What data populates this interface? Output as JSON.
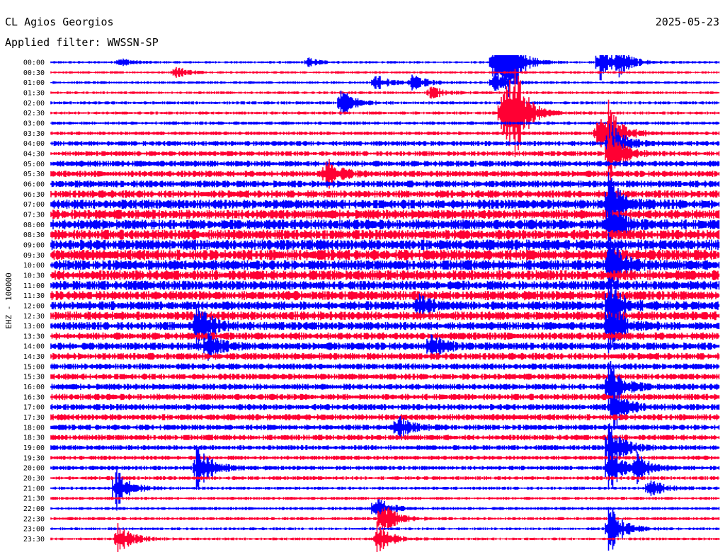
{
  "station": "CL Agios Georgios",
  "date": "2025-05-23",
  "filter_label": "Applied filter: WWSSN-SP",
  "channel_label": "EHZ - 100000",
  "colors": {
    "trace_a": "#0000ff",
    "trace_b": "#ff0033",
    "background": "#ffffff",
    "text": "#000000"
  },
  "chart_data": {
    "type": "line",
    "subtype": "helicorder",
    "row_interval_minutes": 30,
    "grid": false,
    "legend": "none",
    "row_labels": [
      "00:00",
      "00:30",
      "01:00",
      "01:30",
      "02:00",
      "02:30",
      "03:00",
      "03:30",
      "04:00",
      "04:30",
      "05:00",
      "05:30",
      "06:00",
      "06:30",
      "07:00",
      "07:30",
      "08:00",
      "08:30",
      "09:00",
      "09:30",
      "10:00",
      "10:30",
      "11:00",
      "11:30",
      "12:00",
      "12:30",
      "13:00",
      "13:30",
      "14:00",
      "14:30",
      "15:00",
      "15:30",
      "16:00",
      "16:30",
      "17:00",
      "17:30",
      "18:00",
      "18:30",
      "19:00",
      "19:30",
      "20:00",
      "20:30",
      "21:00",
      "21:30",
      "22:00",
      "22:30",
      "23:00",
      "23:30"
    ],
    "row_noise": [
      0.2,
      0.2,
      0.22,
      0.22,
      0.25,
      0.25,
      0.28,
      0.3,
      0.4,
      0.4,
      0.5,
      0.5,
      0.55,
      0.6,
      0.75,
      0.75,
      0.8,
      0.8,
      0.85,
      0.85,
      0.8,
      0.8,
      0.75,
      0.75,
      0.7,
      0.7,
      0.65,
      0.6,
      0.6,
      0.55,
      0.5,
      0.5,
      0.5,
      0.5,
      0.5,
      0.5,
      0.45,
      0.45,
      0.4,
      0.35,
      0.35,
      0.3,
      0.25,
      0.25,
      0.25,
      0.25,
      0.22,
      0.22
    ],
    "events": [
      {
        "row": 0,
        "minute": 3.0,
        "amp": 0.8
      },
      {
        "row": 0,
        "minute": 11.5,
        "amp": 0.7
      },
      {
        "row": 0,
        "minute": 19.8,
        "amp": 3.5
      },
      {
        "row": 0,
        "minute": 20.2,
        "amp": 4.0
      },
      {
        "row": 0,
        "minute": 20.5,
        "amp": 3.8
      },
      {
        "row": 0,
        "minute": 24.6,
        "amp": 3.5
      },
      {
        "row": 0,
        "minute": 25.5,
        "amp": 2.0
      },
      {
        "row": 1,
        "minute": 5.5,
        "amp": 1.2
      },
      {
        "row": 2,
        "minute": 14.5,
        "amp": 1.5
      },
      {
        "row": 2,
        "minute": 16.2,
        "amp": 1.5
      },
      {
        "row": 2,
        "minute": 19.8,
        "amp": 1.8
      },
      {
        "row": 3,
        "minute": 17.0,
        "amp": 1.2
      },
      {
        "row": 4,
        "minute": 13.0,
        "amp": 2.5
      },
      {
        "row": 5,
        "minute": 20.2,
        "amp": 4.5
      },
      {
        "row": 5,
        "minute": 20.5,
        "amp": 5.0
      },
      {
        "row": 5,
        "minute": 20.8,
        "amp": 4.5
      },
      {
        "row": 7,
        "minute": 24.5,
        "amp": 3.0
      },
      {
        "row": 7,
        "minute": 25.0,
        "amp": 4.5
      },
      {
        "row": 8,
        "minute": 25.0,
        "amp": 4.5
      },
      {
        "row": 9,
        "minute": 25.0,
        "amp": 5.0
      },
      {
        "row": 11,
        "minute": 12.3,
        "amp": 3.0
      },
      {
        "row": 14,
        "minute": 25.0,
        "amp": 5.0
      },
      {
        "row": 16,
        "minute": 25.0,
        "amp": 5.0
      },
      {
        "row": 20,
        "minute": 25.0,
        "amp": 5.0
      },
      {
        "row": 24,
        "minute": 25.0,
        "amp": 5.0
      },
      {
        "row": 24,
        "minute": 16.5,
        "amp": 1.5
      },
      {
        "row": 26,
        "minute": 6.5,
        "amp": 5.0
      },
      {
        "row": 26,
        "minute": 25.0,
        "amp": 5.0
      },
      {
        "row": 28,
        "minute": 7.0,
        "amp": 2.5
      },
      {
        "row": 28,
        "minute": 17.0,
        "amp": 2.2
      },
      {
        "row": 32,
        "minute": 25.0,
        "amp": 5.0
      },
      {
        "row": 34,
        "minute": 25.2,
        "amp": 4.0
      },
      {
        "row": 36,
        "minute": 15.5,
        "amp": 2.0
      },
      {
        "row": 38,
        "minute": 25.0,
        "amp": 5.0
      },
      {
        "row": 40,
        "minute": 6.5,
        "amp": 5.0
      },
      {
        "row": 40,
        "minute": 25.0,
        "amp": 5.0
      },
      {
        "row": 40,
        "minute": 26.3,
        "amp": 2.0
      },
      {
        "row": 42,
        "minute": 2.9,
        "amp": 4.0
      },
      {
        "row": 42,
        "minute": 26.8,
        "amp": 2.0
      },
      {
        "row": 44,
        "minute": 14.5,
        "amp": 2.5
      },
      {
        "row": 45,
        "minute": 14.8,
        "amp": 3.5
      },
      {
        "row": 46,
        "minute": 25.0,
        "amp": 5.0
      },
      {
        "row": 47,
        "minute": 3.0,
        "amp": 3.0
      },
      {
        "row": 47,
        "minute": 14.6,
        "amp": 3.0
      }
    ]
  }
}
